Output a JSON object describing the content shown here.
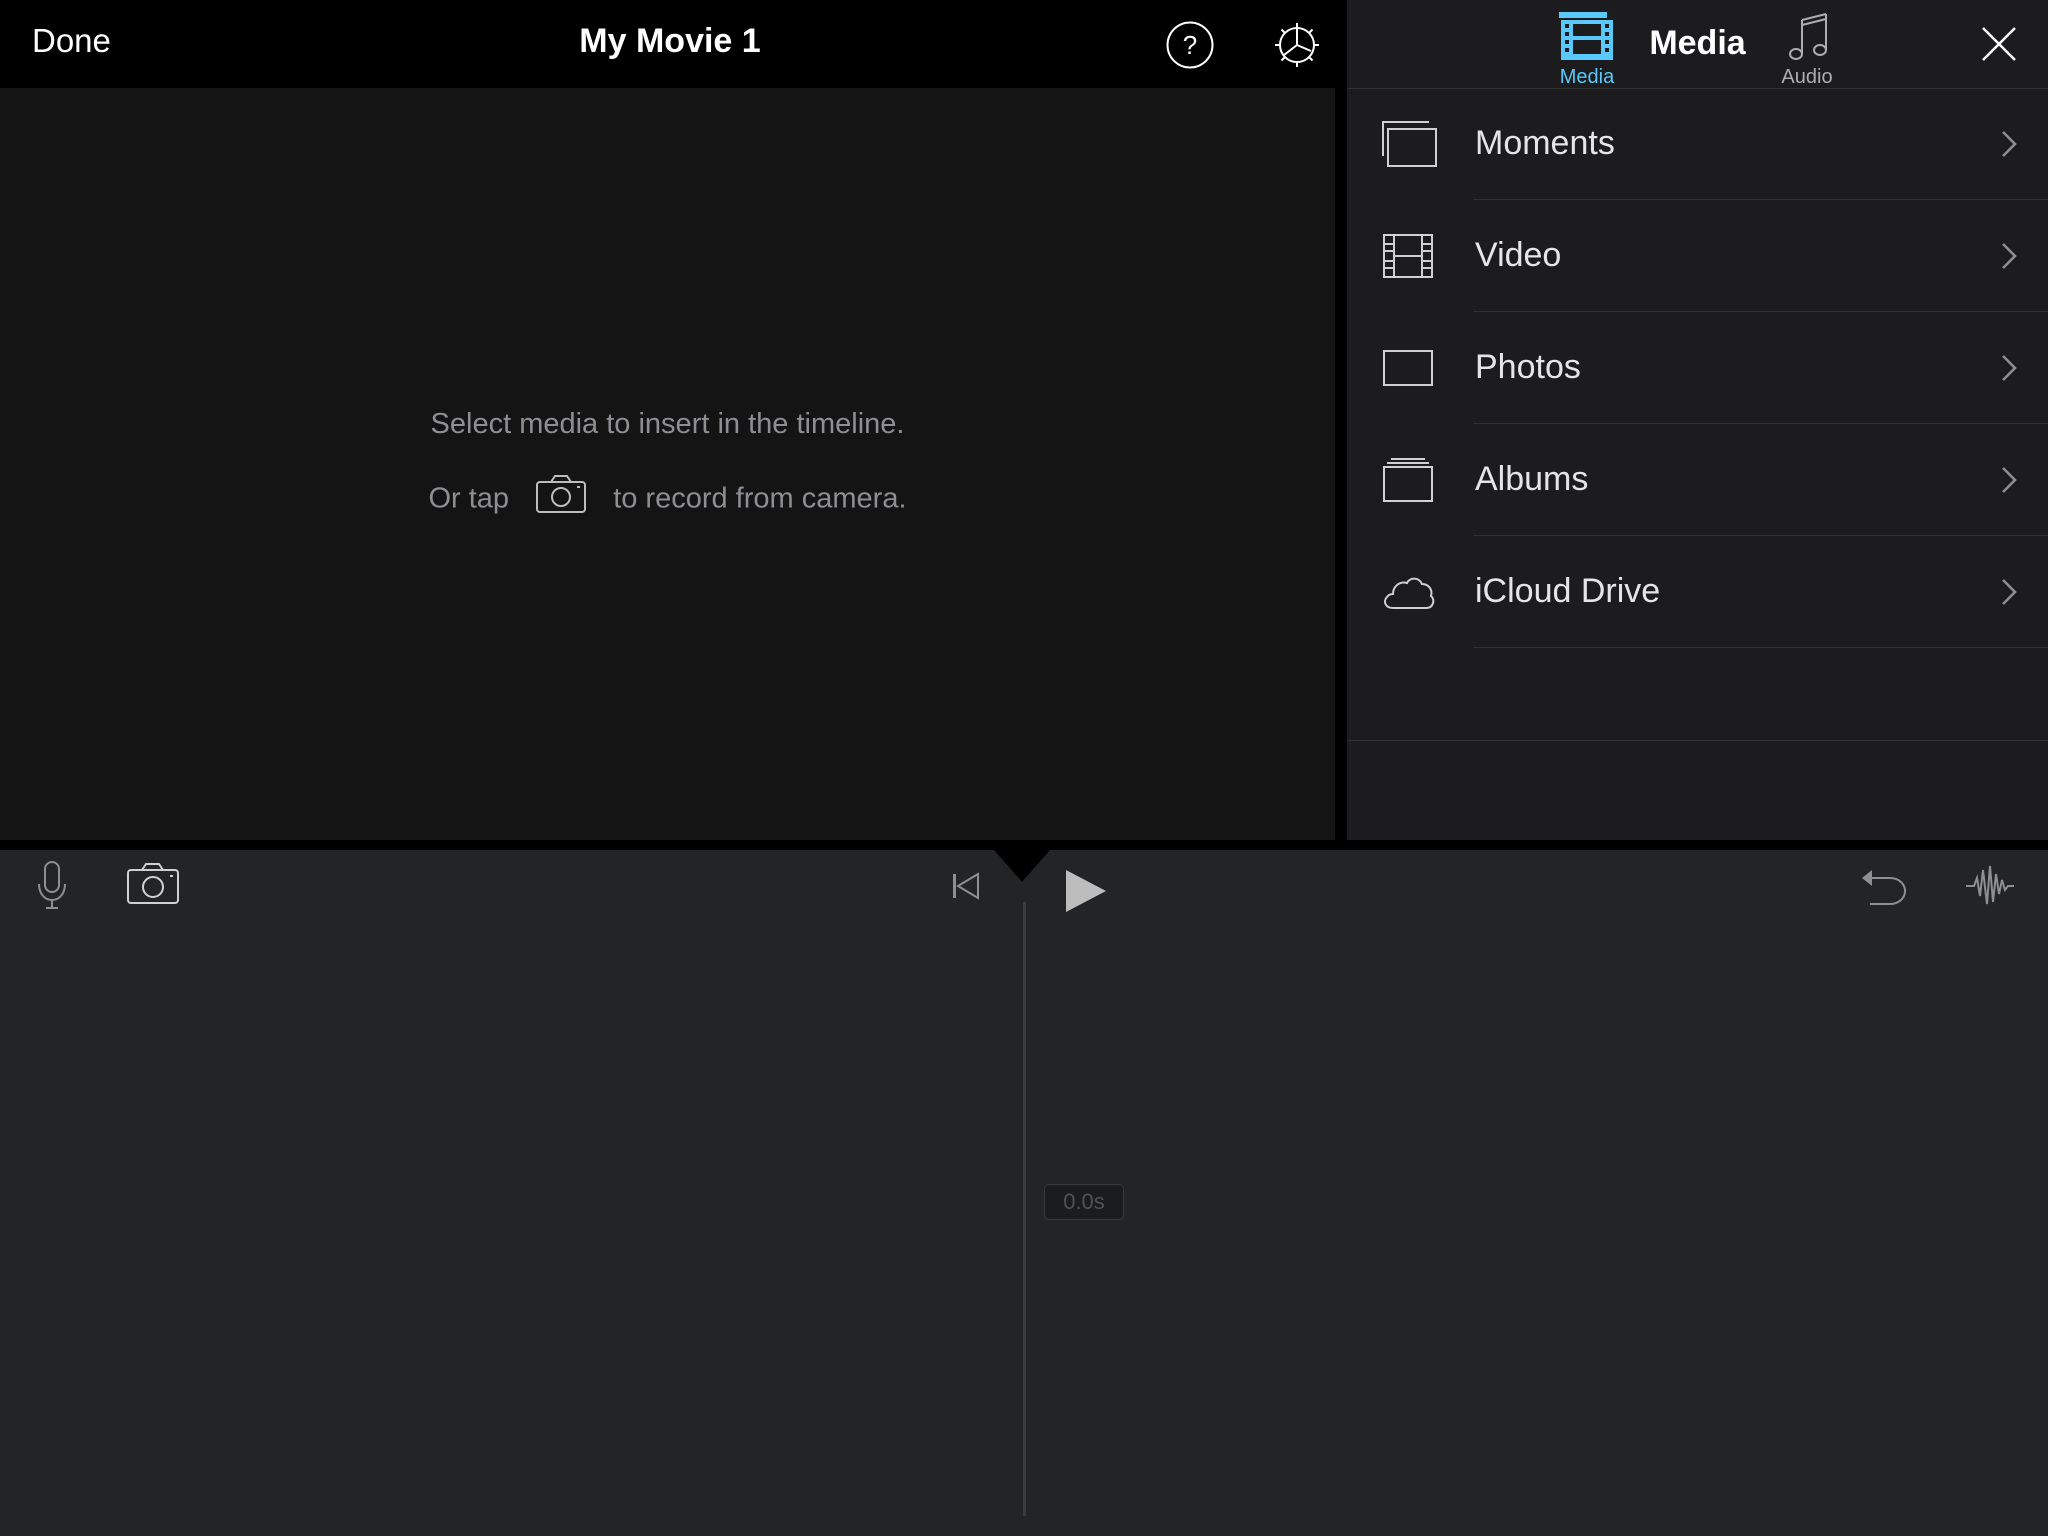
{
  "topbar": {
    "done_label": "Done",
    "movie_title": "My Movie 1"
  },
  "viewer": {
    "line1": "Select media to insert in the timeline.",
    "line2_before": "Or tap",
    "line2_after": "to record from camera."
  },
  "media_panel": {
    "title": "Media",
    "items": [
      {
        "label": "Moments",
        "icon": "moments-icon"
      },
      {
        "label": "Video",
        "icon": "film-icon"
      },
      {
        "label": "Photos",
        "icon": "photo-icon"
      },
      {
        "label": "Albums",
        "icon": "album-icon"
      },
      {
        "label": "iCloud Drive",
        "icon": "cloud-icon"
      }
    ],
    "tabs": [
      {
        "label": "Media",
        "icon": "media-tab-icon",
        "selected": true
      },
      {
        "label": "Audio",
        "icon": "music-note-icon",
        "selected": false
      }
    ]
  },
  "timeline": {
    "time_readout": "0.0s"
  },
  "colors": {
    "accent": "#5ac8fa",
    "viewer_bg": "#141414",
    "panel_bg": "#1c1c1e",
    "timeline_bg": "#232426"
  }
}
